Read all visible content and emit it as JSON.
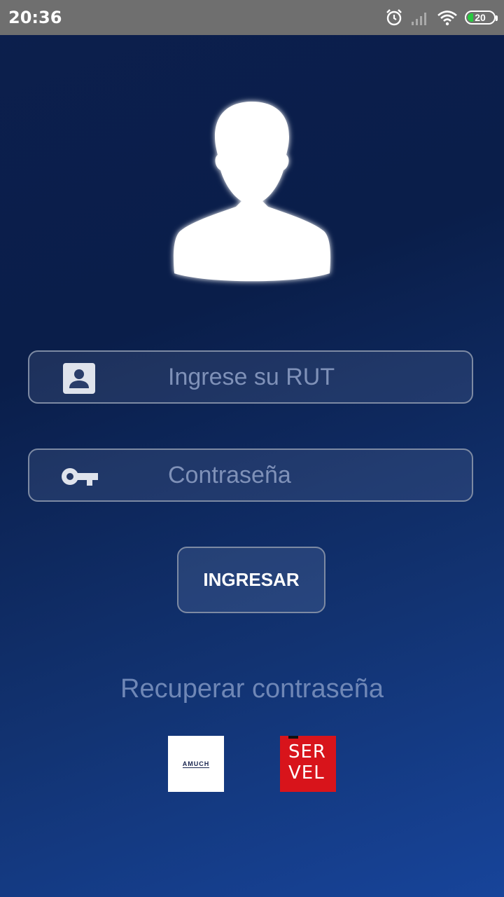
{
  "status_bar": {
    "time": "20:36",
    "battery": "20",
    "icons": [
      "alarm-icon",
      "signal-icon",
      "wifi-icon",
      "battery-icon"
    ]
  },
  "login": {
    "rut_placeholder": "Ingrese su RUT",
    "password_placeholder": "Contraseña",
    "submit_label": "INGRESAR",
    "recover_label": "Recuperar contraseña"
  },
  "logos": {
    "amuch": "AMUCH",
    "servel_top": "SER",
    "servel_bottom": "VEL"
  },
  "colors": {
    "background_top": "#0c1f4d",
    "background_bottom": "#17449a",
    "status_bar": "#6f6f6f",
    "placeholder": "#7f91b8",
    "servel_red": "#d8141b"
  }
}
